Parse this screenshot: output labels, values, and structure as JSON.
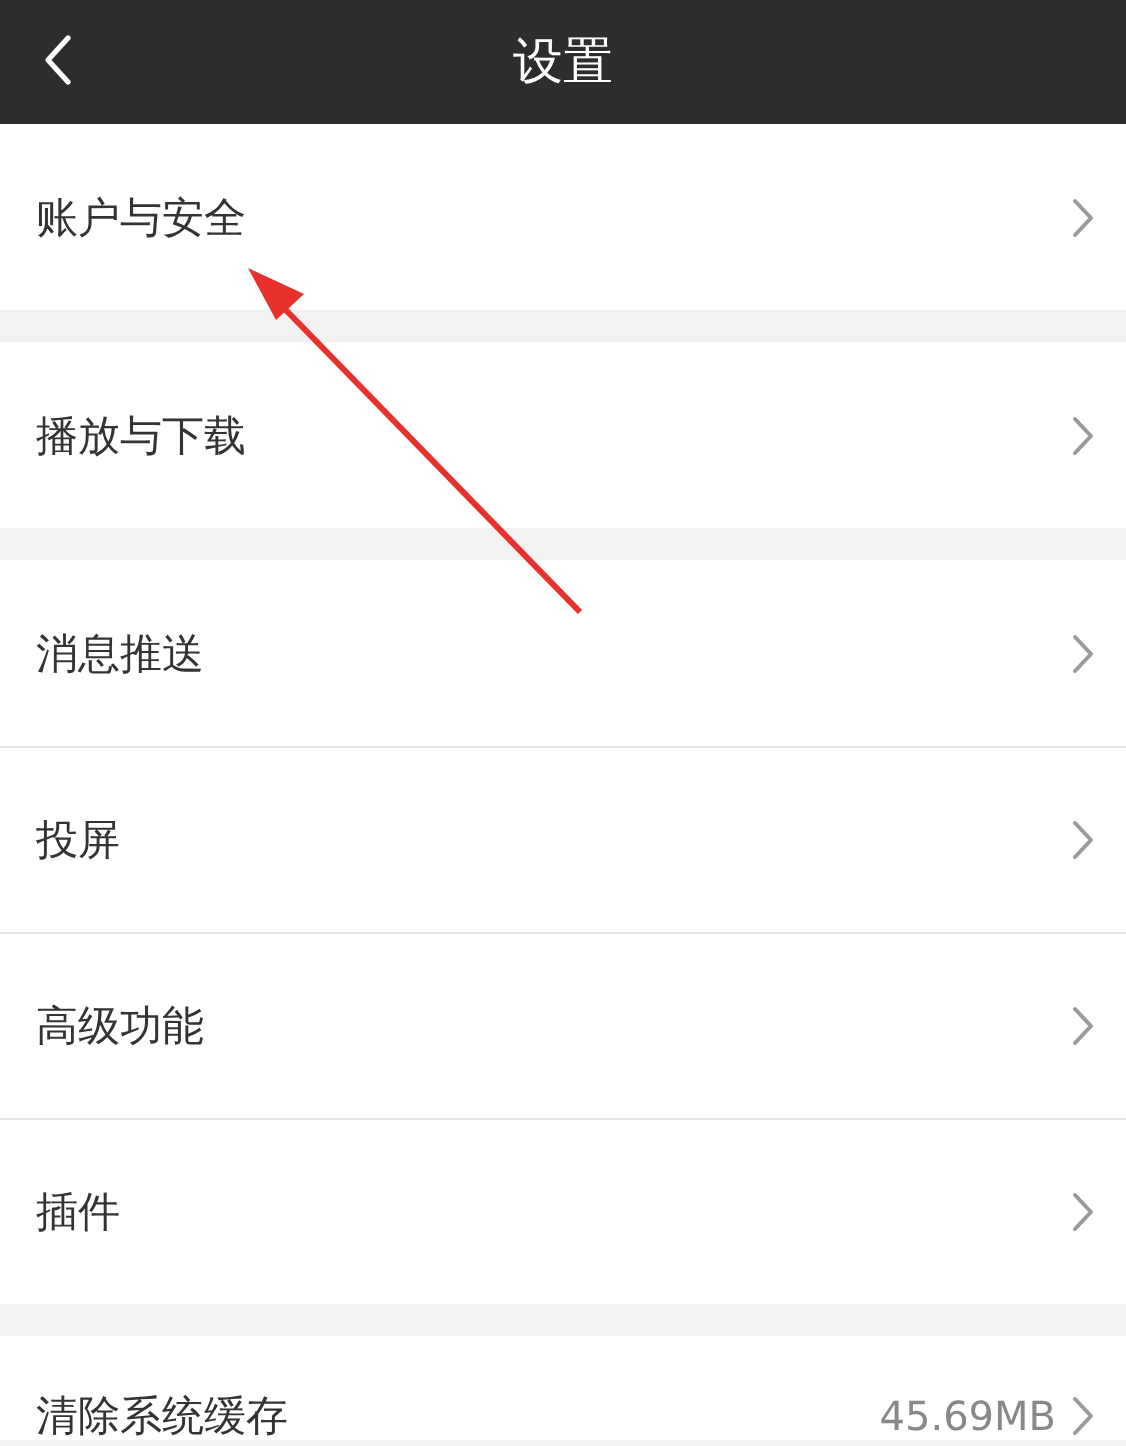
{
  "header": {
    "title": "设置"
  },
  "sections": [
    {
      "items": [
        {
          "label": "账户与安全"
        }
      ]
    },
    {
      "items": [
        {
          "label": "播放与下载"
        }
      ]
    },
    {
      "items": [
        {
          "label": "消息推送"
        },
        {
          "label": "投屏"
        },
        {
          "label": "高级功能"
        },
        {
          "label": "插件"
        }
      ]
    },
    {
      "items": [
        {
          "label": "清除系统缓存",
          "value": "45.69MB"
        }
      ]
    }
  ],
  "annotation": {
    "kind": "arrow"
  }
}
